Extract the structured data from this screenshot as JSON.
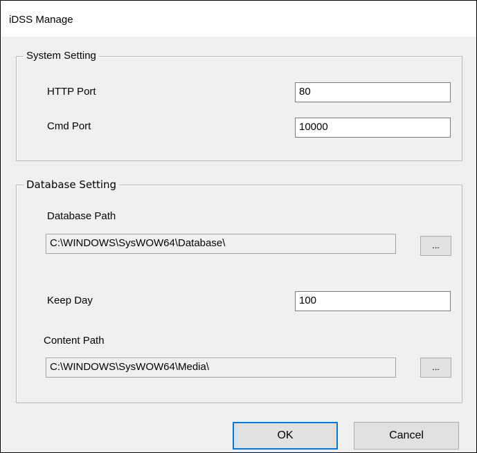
{
  "window": {
    "title": "iDSS Manage"
  },
  "system_setting": {
    "legend": "System Setting",
    "http_port_label": "HTTP Port",
    "http_port_value": "80",
    "cmd_port_label": "Cmd Port",
    "cmd_port_value": "10000"
  },
  "database_setting": {
    "legend": "Database Setting",
    "database_path_label": "Database Path",
    "database_path_value": "C:\\WINDOWS\\SysWOW64\\Database\\",
    "database_browse_label": "...",
    "keep_day_label": "Keep Day",
    "keep_day_value": "100",
    "content_path_label": "Content Path",
    "content_path_value": "C:\\WINDOWS\\SysWOW64\\Media\\",
    "content_browse_label": "..."
  },
  "buttons": {
    "ok": "OK",
    "cancel": "Cancel"
  }
}
